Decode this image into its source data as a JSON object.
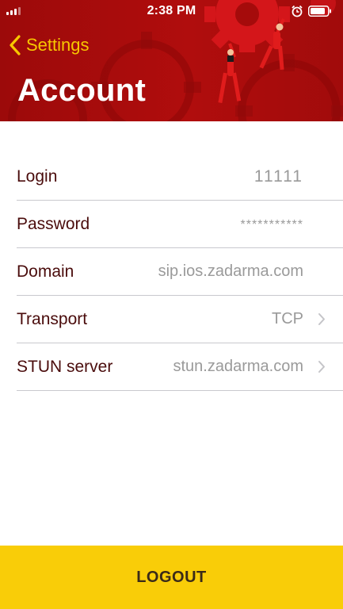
{
  "status_bar": {
    "time": "2:38 PM",
    "signal_icon": "signal-bars-icon",
    "alarm_icon": "alarm-clock-icon",
    "battery_icon": "battery-icon"
  },
  "nav": {
    "back_label": "Settings",
    "back_icon": "chevron-left-icon",
    "title": "Account"
  },
  "fields": [
    {
      "label": "Login",
      "value": "11111"
    },
    {
      "label": "Password",
      "value": "***********"
    },
    {
      "label": "Domain",
      "value": "sip.ios.zadarma.com"
    },
    {
      "label": "Transport",
      "value": "TCP",
      "disclosure": "chevron-right-icon"
    },
    {
      "label": "STUN server",
      "value": "stun.zadarma.com",
      "disclosure": "chevron-right-icon"
    }
  ],
  "logout_label": "LOGOUT",
  "colors": {
    "header_red": "#b00d0d",
    "accent_yellow": "#f7c600",
    "logout_yellow": "#f9cd08",
    "label_text": "#4a0c0c",
    "value_text": "#9a9a9a"
  }
}
